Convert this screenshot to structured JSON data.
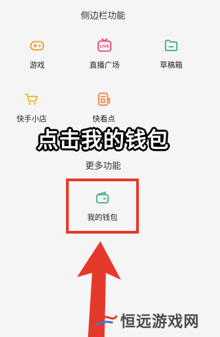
{
  "sidebar_section_title": "侧边栏功能",
  "features": {
    "game": {
      "label": "游戏",
      "icon": "gamepad-icon",
      "color": "#f29a33"
    },
    "live": {
      "label": "直播广场",
      "icon": "live-tv-icon",
      "color": "#f0457c"
    },
    "draft": {
      "label": "草稿箱",
      "icon": "folder-icon",
      "color": "#3fb08a"
    },
    "shop": {
      "label": "快手小店",
      "icon": "shopping-cart-icon",
      "color": "#f3b523"
    },
    "kan": {
      "label": "快看点",
      "icon": "document-icon",
      "color": "#f0803a"
    }
  },
  "overlay_banner": "点击我的钱包",
  "more_section_title": "更多功能",
  "wallet": {
    "label": "我的钱包",
    "icon": "wallet-icon",
    "color": "#3fb08a"
  },
  "highlight_color": "#e53a2b",
  "watermark": {
    "text": "恒远游戏网",
    "icon": "logo-icon"
  }
}
